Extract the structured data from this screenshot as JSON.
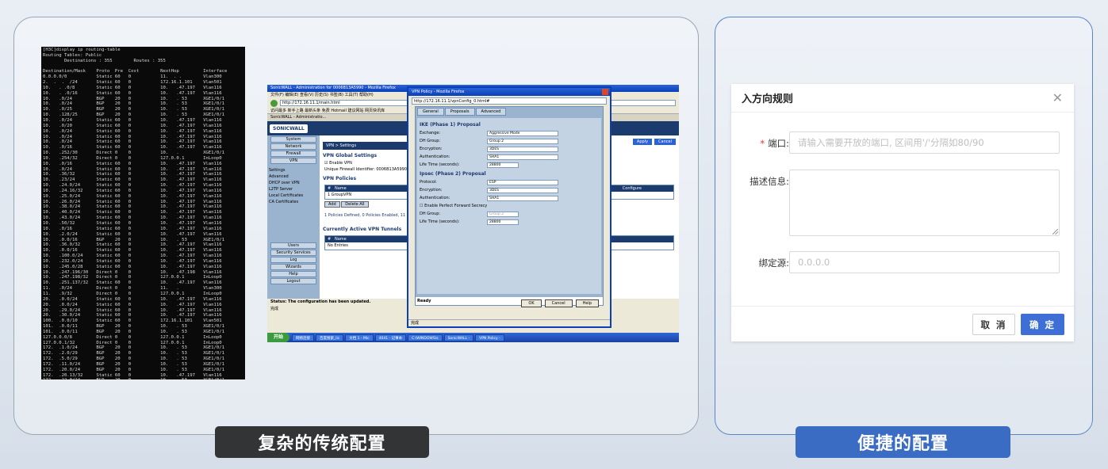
{
  "captions": {
    "left": "复杂的传统配置",
    "right": "便捷的配置"
  },
  "terminal": {
    "command": "[H3C]display ip routing-table",
    "tables": "Routing Tables: Public",
    "counts": "        Destinations : 355        Routes : 355",
    "columns": "Destination/Mask    Proto  Pre  Cost        NextHop         Interface",
    "rows": [
      "0.0.0.0/0           Static 60   0           11.  . .        Vlan300",
      "2.  .  .  /24       Static 60   0           172.16.1.101    Vlan501",
      "10.   . .0/8        Static 60   0           10.   .47.197   Vlan116",
      "10.   . .0/16       Static 60   0           10.   .47.197   Vlan116",
      "10.   .0/24         BGP    20   0           10.   . 53      XGE1/0/1",
      "10.   .0/24         BGP    20   0           10.   . 53      XGE1/0/1",
      "10.   .0/25         BGP    20   0           10.   . 53      XGE1/0/1",
      "10.   .128/25       BGP    20   0           10.   . 53      XGE1/0/1",
      "10.   .0/24         Static 60   0           10.   .47.197   Vlan116",
      "10.   .0/20         Static 60   0           10.   .47.197   Vlan116",
      "10.   .0/24         Static 60   0           10.   .47.197   Vlan116",
      "10.   .0/24         Static 60   0           10.   .47.197   Vlan116",
      "10.   .0/24         Static 60   0           10.   .47.197   Vlan116",
      "10.   .0/16         Static 60   0           10.   .47.197   Vlan116",
      "10.   .252/30       Direct 0    0           10.   .         XGE1/0/1",
      "10.   .254/32       Direct 0    0           127.0.0.1       InLoop0",
      "10.   .0/16         Static 60   0           10.   .47.197   Vlan116",
      "10.   .0/24         Static 60   0           10.   .47.197   Vlan116",
      "10.   .36/32        Static 60   0           10.   .47.197   Vlan116",
      "10.   .23/24        Static 60   0           10.   .47.197   Vlan116",
      "10.   .24.0/24      Static 60   0           10.   .47.197   Vlan116",
      "10.   .24.16/32     Static 60   0           10.   .47.197   Vlan116",
      "10.   .25.0/24      Static 60   0           10.   .47.197   Vlan116",
      "10.   .26.0/24      Static 60   0           10.   .47.197   Vlan116",
      "10.   .38.0/24      Static 60   0           10.   .47.197   Vlan116",
      "10.   .40.0/24      Static 60   0           10.   .47.197   Vlan116",
      "10.   .43.0/24      Static 60   0           10.   .47.197   Vlan116",
      "10.   .50/32        Static 60   0           10.   .47.197   Vlan116",
      "10.   .0/16         Static 60   0           10.   .47.197   Vlan116",
      "10.   .2.0/24       Static 60   0           10.   .47.197   Vlan116",
      "10.   .0.0/16       BGP    20   0           10.   . 53      XGE1/0/1",
      "10.   .36.0/32      Static 60   0           10.   .47.197   Vlan116",
      "10.   .0.0/16       Static 60   0           10.   .47.197   Vlan116",
      "10.   .100.0/24     Static 60   0           10.   .47.197   Vlan116",
      "10.   .232.0/24     Static 60   0           10.   .47.197   Vlan116",
      "10.   .245.0/28     Static 60   0           10.   .47.197   Vlan116",
      "10.   .247.196/30   Direct 0    0           10.   .47.198   Vlan116",
      "10.   .247.198/32   Direct 0    0           127.0.0.1       InLoop0",
      "10.   .251.137/32   Static 60   0           10.   .47.197   Vlan116",
      "11.   .0/24         Direct 0    0           11.   .         Vlan300",
      "11.   .9/32         Direct 0    0           127.0.0.1       InLoop0",
      "20.   .0.0/24       Static 60   0           10.   .47.197   Vlan116",
      "20.   .0.0/24       Static 60   0           10.   .47.197   Vlan116",
      "20.   .29.0/24      Static 60   0           10.   .47.197   Vlan116",
      "20.   .30.0/24      Static 60   0           10.   .47.197   Vlan116",
      "100.  .0.0/10       Static 60   0           172.16.1.101    Vlan501",
      "101.  .0.0/11       BGP    20   0           10.   . 53      XGE1/0/1",
      "101.  .0.0/11       BGP    20   0           10.   . 53      XGE1/0/1",
      "127.0.0.0/8         Direct 0    0           127.0.0.1       InLoop0",
      "127.0.0.1/32        Direct 0    0           127.0.0.1       InLoop0",
      "172.  .1.0/24       BGP    20   0           10.   . 53      XGE1/0/1",
      "172.  .2.0/29       BGP    20   0           10.   . 53      XGE1/0/1",
      "172.  .5.0/29       BGP    20   0           10.   . 53      XGE1/0/1",
      "172.  .11.0/24      BGP    20   0           10.   . 53      XGE1/0/1",
      "172.  .20.0/24      BGP    20   0           10.   . 53      XGE1/0/1",
      "172.  .20.13/32     Static 60   0           10.   .47.197   Vlan116",
      "172.  .22.0/24      BGP    20   0           10.   . 53      XGE1/0/1",
      "172.  .33.0/24      BGP    20   0           10.   . 53      XGE1/0/1",
      "172.  .34.0/24      BGP    20   0           10.   . 53      XGE1/0/1",
      "172.  .35.0/24      BGP    20   0           10.   . 53      XGE1/0/1",
      "172.  .35.251/32    BGP    20   0           10.   . 53      XGE1/0/1",
      "172.  .36.0/24      BGP    20   0           10.   . 53      XGE1/0/1",
      "172.  .37.0/24      BGP    20   0           10.   . 53      XGE1/0/1"
    ]
  },
  "sonicwall": {
    "window_title": "SonicWALL - Administration for 0006B13A5990 - Mozilla Firefox",
    "menu": "文件(F)  编辑(E)  查看(V)  历史(S)  书签(B)  工具(T)  帮助(H)",
    "url": "http://172.16.11.1/main.html",
    "bookmarks": "访问最多   新手上路   最新头条   免费 Hotmail   建议网站   网页快讯库",
    "tab": "SonicWALL - Administratio...",
    "logo": "SONICWALL",
    "nav_buttons": [
      "System",
      "Network",
      "Firewall",
      "VPN"
    ],
    "nav_tree": [
      "Settings",
      "Advanced",
      "DHCP over VPN",
      "L2TP Server",
      "Local Certificates",
      "CA Certificates"
    ],
    "nav_bottom": [
      "Users",
      "Security Services",
      "Log",
      "Wizards",
      "Help",
      "Logout"
    ],
    "header": "VPN > Settings",
    "apply": "Apply",
    "cancel": "Cancel",
    "global_title": "VPN Global Settings",
    "enable_vpn": "Enable VPN",
    "unique_id": "Unique Firewall Identifier:  0006B13A5990",
    "policies_title": "VPN Policies",
    "col_name": "Name",
    "col_configure": "Configure",
    "policy_row": "1    GroupVPN",
    "add": "Add",
    "delete_all": "Delete All",
    "policies_defined": "1 Policies Defined, 0 Policies Enabled, 11 Max",
    "tunnels_title": "Currently Active VPN Tunnels",
    "no_entries": "No Entries",
    "status": "Status: The configuration has been updated.",
    "done": "完成",
    "start": "开始",
    "taskbar": [
      "网络连接",
      "百度搜索_lic",
      "文档 1 - Mic",
      "4041 - 记事本",
      "C:\\WINDOWS\\s",
      "SonicWALL -",
      "VPN Policy -"
    ]
  },
  "vpn_policy": {
    "title": "VPN Policy - Mozilla Firefox",
    "url": "http://172.16.11.1/vpnConfig_0.html#",
    "tabs": [
      "General",
      "Proposals",
      "Advanced"
    ],
    "ike_title": "IKE (Phase 1) Proposal",
    "ike_fields": [
      {
        "label": "Exchange:",
        "value": "Aggressive Mode"
      },
      {
        "label": "DH Group:",
        "value": "Group 2"
      },
      {
        "label": "Encryption:",
        "value": "3DES"
      },
      {
        "label": "Authentication:",
        "value": "SHA1"
      }
    ],
    "ike_lifetime_label": "Life Time (seconds):",
    "ike_lifetime": "28800",
    "ipsec_title": "Ipsec (Phase 2) Proposal",
    "ipsec_fields": [
      {
        "label": "Protocol:",
        "value": "ESP"
      },
      {
        "label": "Encryption:",
        "value": "3DES"
      },
      {
        "label": "Authentication:",
        "value": "SHA1"
      }
    ],
    "pfs": "Enable Perfect Forward Secrecy",
    "dh_group_label": "DH Group:",
    "dh_group_value": "Group 2",
    "ipsec_lifetime_label": "Life Time (seconds):",
    "ipsec_lifetime": "28800",
    "ready": "Ready",
    "ok": "OK",
    "cancel": "Cancel",
    "help": "Help",
    "done": "完成"
  },
  "dialog": {
    "title": "入方向规则",
    "port_label": "端口:",
    "port_placeholder": "请输入需要开放的端口, 区间用'/'分隔如80/90",
    "desc_label": "描述信息:",
    "source_label": "绑定源:",
    "source_placeholder": "0.0.0.0",
    "cancel": "取 消",
    "ok": "确 定"
  }
}
